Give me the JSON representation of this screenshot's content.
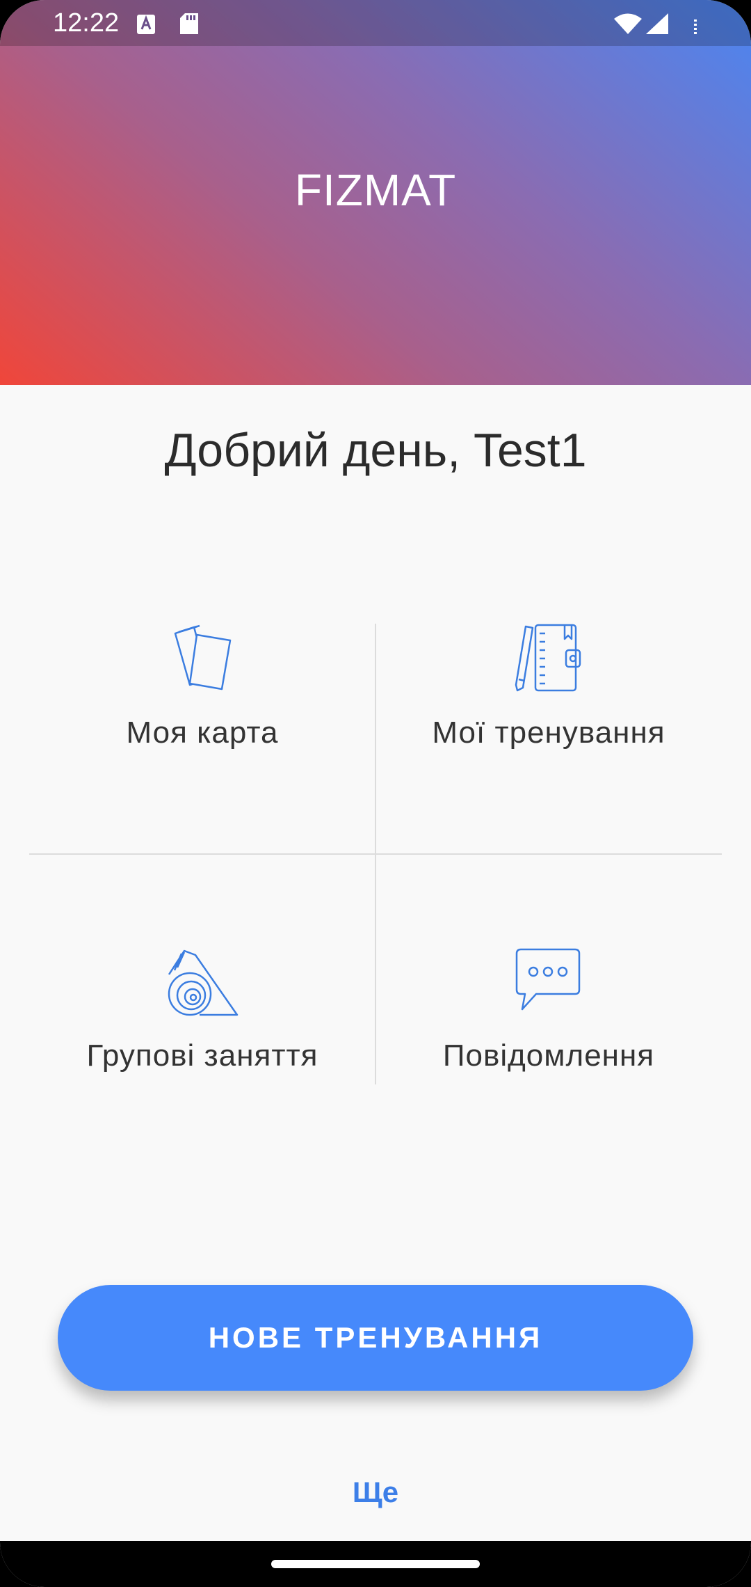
{
  "status_bar": {
    "time": "12:22",
    "icons": [
      "accessibility-a-icon",
      "sd-card-icon",
      "wifi-icon",
      "signal-icon",
      "battery-icon"
    ]
  },
  "header": {
    "brand": "FIZMAT",
    "gradient": [
      "#f0463a",
      "#a8608c",
      "#8a6cb2",
      "#4a86f2"
    ]
  },
  "greeting": "Добрий день, Test1",
  "tiles": [
    {
      "label": "Моя карта",
      "icon": "cards-icon"
    },
    {
      "label": "Мої тренування",
      "icon": "notebook-pencil-icon"
    },
    {
      "label": "Групові заняття",
      "icon": "yoga-mat-icon"
    },
    {
      "label": "Повідомлення",
      "icon": "chat-bubble-icon"
    }
  ],
  "primary_button": {
    "label": "НОВЕ ТРЕНУВАННЯ",
    "color": "#4689fb"
  },
  "more_link": {
    "label": "Ще",
    "color": "#3d7fe8"
  },
  "accent_icon_color": "#3b7de0"
}
